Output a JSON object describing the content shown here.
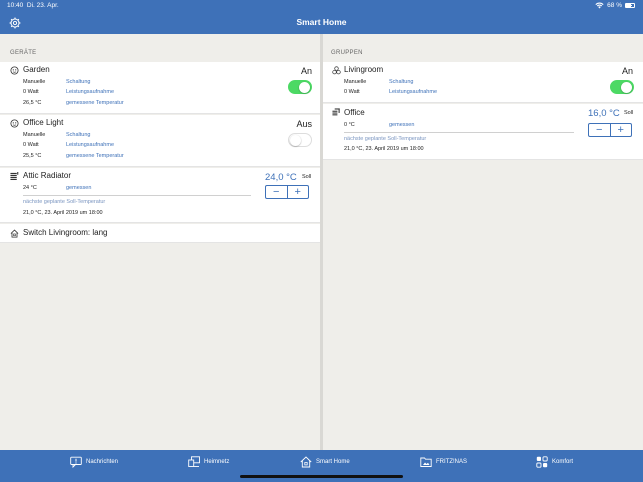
{
  "status": {
    "time": "10:40",
    "date": "Di. 23. Apr.",
    "battery": "68 %",
    "battery_level": 0.68
  },
  "header": {
    "title": "Smart Home"
  },
  "devices": {
    "section_label": "GERÄTE",
    "garden": {
      "name": "Garden",
      "state": "An",
      "mode_label": "Manuelle",
      "mode_value": "Schaltung",
      "power_label": "0 Watt",
      "power_value": "Leistungsaufnahme",
      "temp_label": "26,5 °C",
      "temp_value": "gemessene Temperatur",
      "toggle_on": true
    },
    "office_light": {
      "name": "Office Light",
      "state": "Aus",
      "mode_label": "Manuelle",
      "mode_value": "Schaltung",
      "power_label": "0 Watt",
      "power_value": "Leistungsaufnahme",
      "temp_label": "25,5 °C",
      "temp_value": "gemessene Temperatur",
      "toggle_on": false
    },
    "attic_radiator": {
      "name": "Attic Radiator",
      "set_temp": "24,0 °C",
      "soll": "Soll",
      "measured_label": "24 °C",
      "measured_value": "gemessen",
      "next_label": "nächste geplante Soll-Temperatur",
      "next_value": "21,0 °C, 23. April 2019 um 18:00"
    },
    "switch": {
      "name": "Switch Livingroom: lang"
    }
  },
  "groups": {
    "section_label": "GRUPPEN",
    "livingroom": {
      "name": "Livingroom",
      "state": "An",
      "mode_label": "Manuelle",
      "mode_value": "Schaltung",
      "power_label": "0 Watt",
      "power_value": "Leistungsaufnahme",
      "toggle_on": true
    },
    "office": {
      "name": "Office",
      "set_temp": "16,0 °C",
      "soll": "Soll",
      "measured_label": "0 °C",
      "measured_value": "gemessen",
      "next_label": "nächste geplante Soll-Temperatur",
      "next_value": "21,0 °C, 23. April 2019 um 18:00"
    }
  },
  "stepper": {
    "minus": "−",
    "plus": "+"
  },
  "tabs": [
    {
      "label": "Nachrichten",
      "icon": "message-icon"
    },
    {
      "label": "Heimnetz",
      "icon": "network-icon"
    },
    {
      "label": "Smart Home",
      "icon": "home-icon"
    },
    {
      "label": "FRITZ!NAS",
      "icon": "nas-icon"
    },
    {
      "label": "Komfort",
      "icon": "comfort-icon"
    }
  ],
  "colors": {
    "accent": "#3e71b8",
    "toggle_on": "#4cd964"
  }
}
